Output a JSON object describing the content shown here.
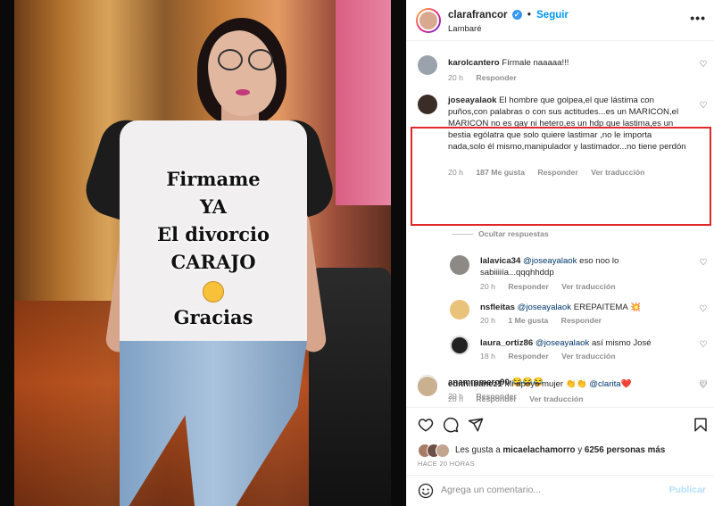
{
  "photo": {
    "shirt_lines": [
      "Firmame",
      "YA",
      "El divorcio",
      "CARAJO",
      "Gracias"
    ],
    "emoji": "smiling-face"
  },
  "header": {
    "username": "clarafrancor",
    "dot": "•",
    "follow_label": "Seguir",
    "location": "Lambaré",
    "more_label": "•••"
  },
  "comments": [
    {
      "user": "karolcantero",
      "text": "Fírmale naaaaa!!!",
      "time": "20 h",
      "reply": "Responder"
    },
    {
      "user": "joseayalaok",
      "text": "El hombre que golpea,el que lástima con puños,con palabras o con sus actitudes...es un MARICON,el MARICON no es gay ni hetero,es un hdp que lastima,es un bestia ególatra que solo quiere lastimar ,no le importa nada,solo él mismo,manipulador y lastimador...no tiene perdón",
      "time": "20 h",
      "likes": "187 Me gusta",
      "reply": "Responder",
      "translate": "Ver traducción"
    },
    {
      "user": "lalavica34",
      "mention": "@joseayalaok",
      "text": "eso noo lo sabiiiiía...qqqhhddp",
      "time": "20 h",
      "reply": "Responder",
      "translate": "Ver traducción"
    },
    {
      "user": "nsfleitas",
      "mention": "@joseayalaok",
      "text": "EREPAITEMA 💥",
      "time": "20 h",
      "likes": "1 Me gusta",
      "reply": "Responder"
    },
    {
      "user": "laura_ortiz86",
      "mention": "@joseayalaok",
      "text": "así mismo José",
      "time": "18 h",
      "reply": "Responder",
      "translate": "Ver traducción"
    },
    {
      "user": "anamromero90",
      "text": "😂😂😂",
      "time": "20 h",
      "reply": "Responder"
    },
    {
      "user": "edith.ibanez1",
      "text": "Mi apoyo mujer 👏👏",
      "mention_after": "@clarita❤️",
      "time": "20 h",
      "reply": "Responder",
      "translate": "Ver traducción"
    }
  ],
  "hidden_replies_label": "Ocultar respuestas",
  "likes": {
    "prefix": "Les gusta a ",
    "user": "micaelachamorro",
    "middle": " y ",
    "count": "6256 personas más",
    "ago": "HACE 20 HORAS"
  },
  "composer": {
    "placeholder": "Agrega un comentario...",
    "publish_label": "Publicar"
  },
  "colors": {
    "link": "#0095f6",
    "highlight_border": "#e0282a",
    "muted": "#8e8e8e"
  }
}
